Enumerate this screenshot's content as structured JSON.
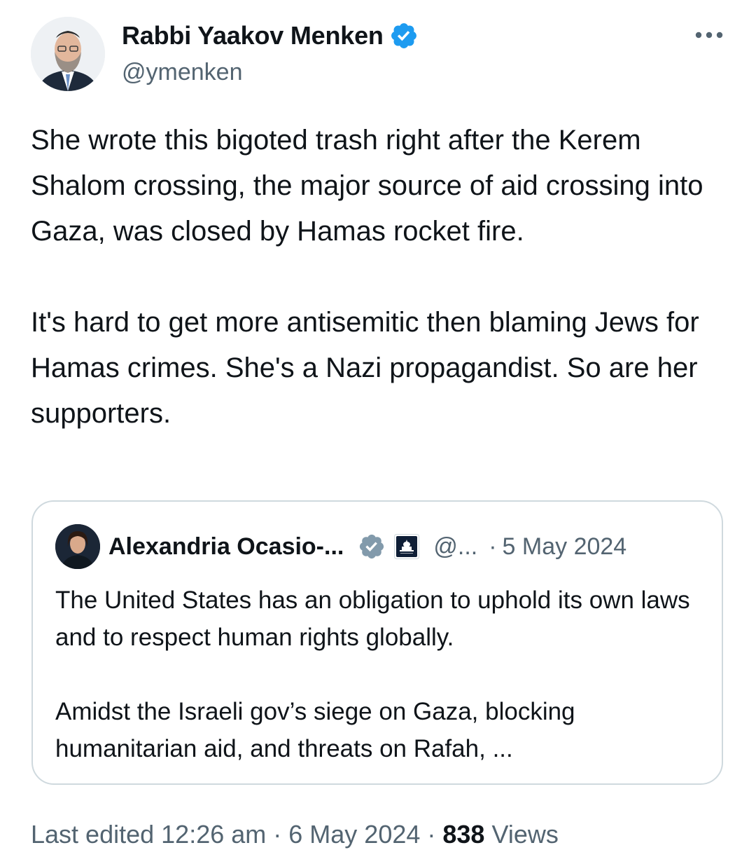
{
  "author": {
    "display_name": "Rabbi Yaakov Menken",
    "handle": "@ymenken",
    "verified_icon": "verified-badge-icon",
    "avatar_icon": "author-avatar"
  },
  "more_icon": "more-horizontal-icon",
  "tweet": {
    "text": "She wrote this bigoted trash right after the Kerem Shalom crossing, the major source of aid crossing into Gaza, was closed by Hamas rocket fire.\n\nIt's hard to get more antisemitic then blaming Jews for Hamas crimes. She's a Nazi propagandist. So are her supporters."
  },
  "quote": {
    "display_name": "Alexandria Ocasio-...",
    "handle": "@...",
    "separator": "·",
    "date": "5 May 2024",
    "text": "The United States has an obligation to uphold its own laws and to respect human rights globally.\n\nAmidst the Israeli gov’s siege on Gaza, blocking humanitarian aid, and threats on Rafah, ...",
    "badge_icon": "government-verified-badge-icon",
    "affiliation_icon": "us-capitol-affiliation-icon"
  },
  "meta": {
    "edited_label": "Last edited",
    "time": "12:26 am",
    "separator": "·",
    "date": "6 May 2024",
    "views_count": "838",
    "views_label": "Views"
  },
  "colors": {
    "verified_blue": "#1d9bf0",
    "gov_grey": "#829aab",
    "text_primary": "#0f1419",
    "text_secondary": "#536471",
    "border": "#cfd9de"
  }
}
